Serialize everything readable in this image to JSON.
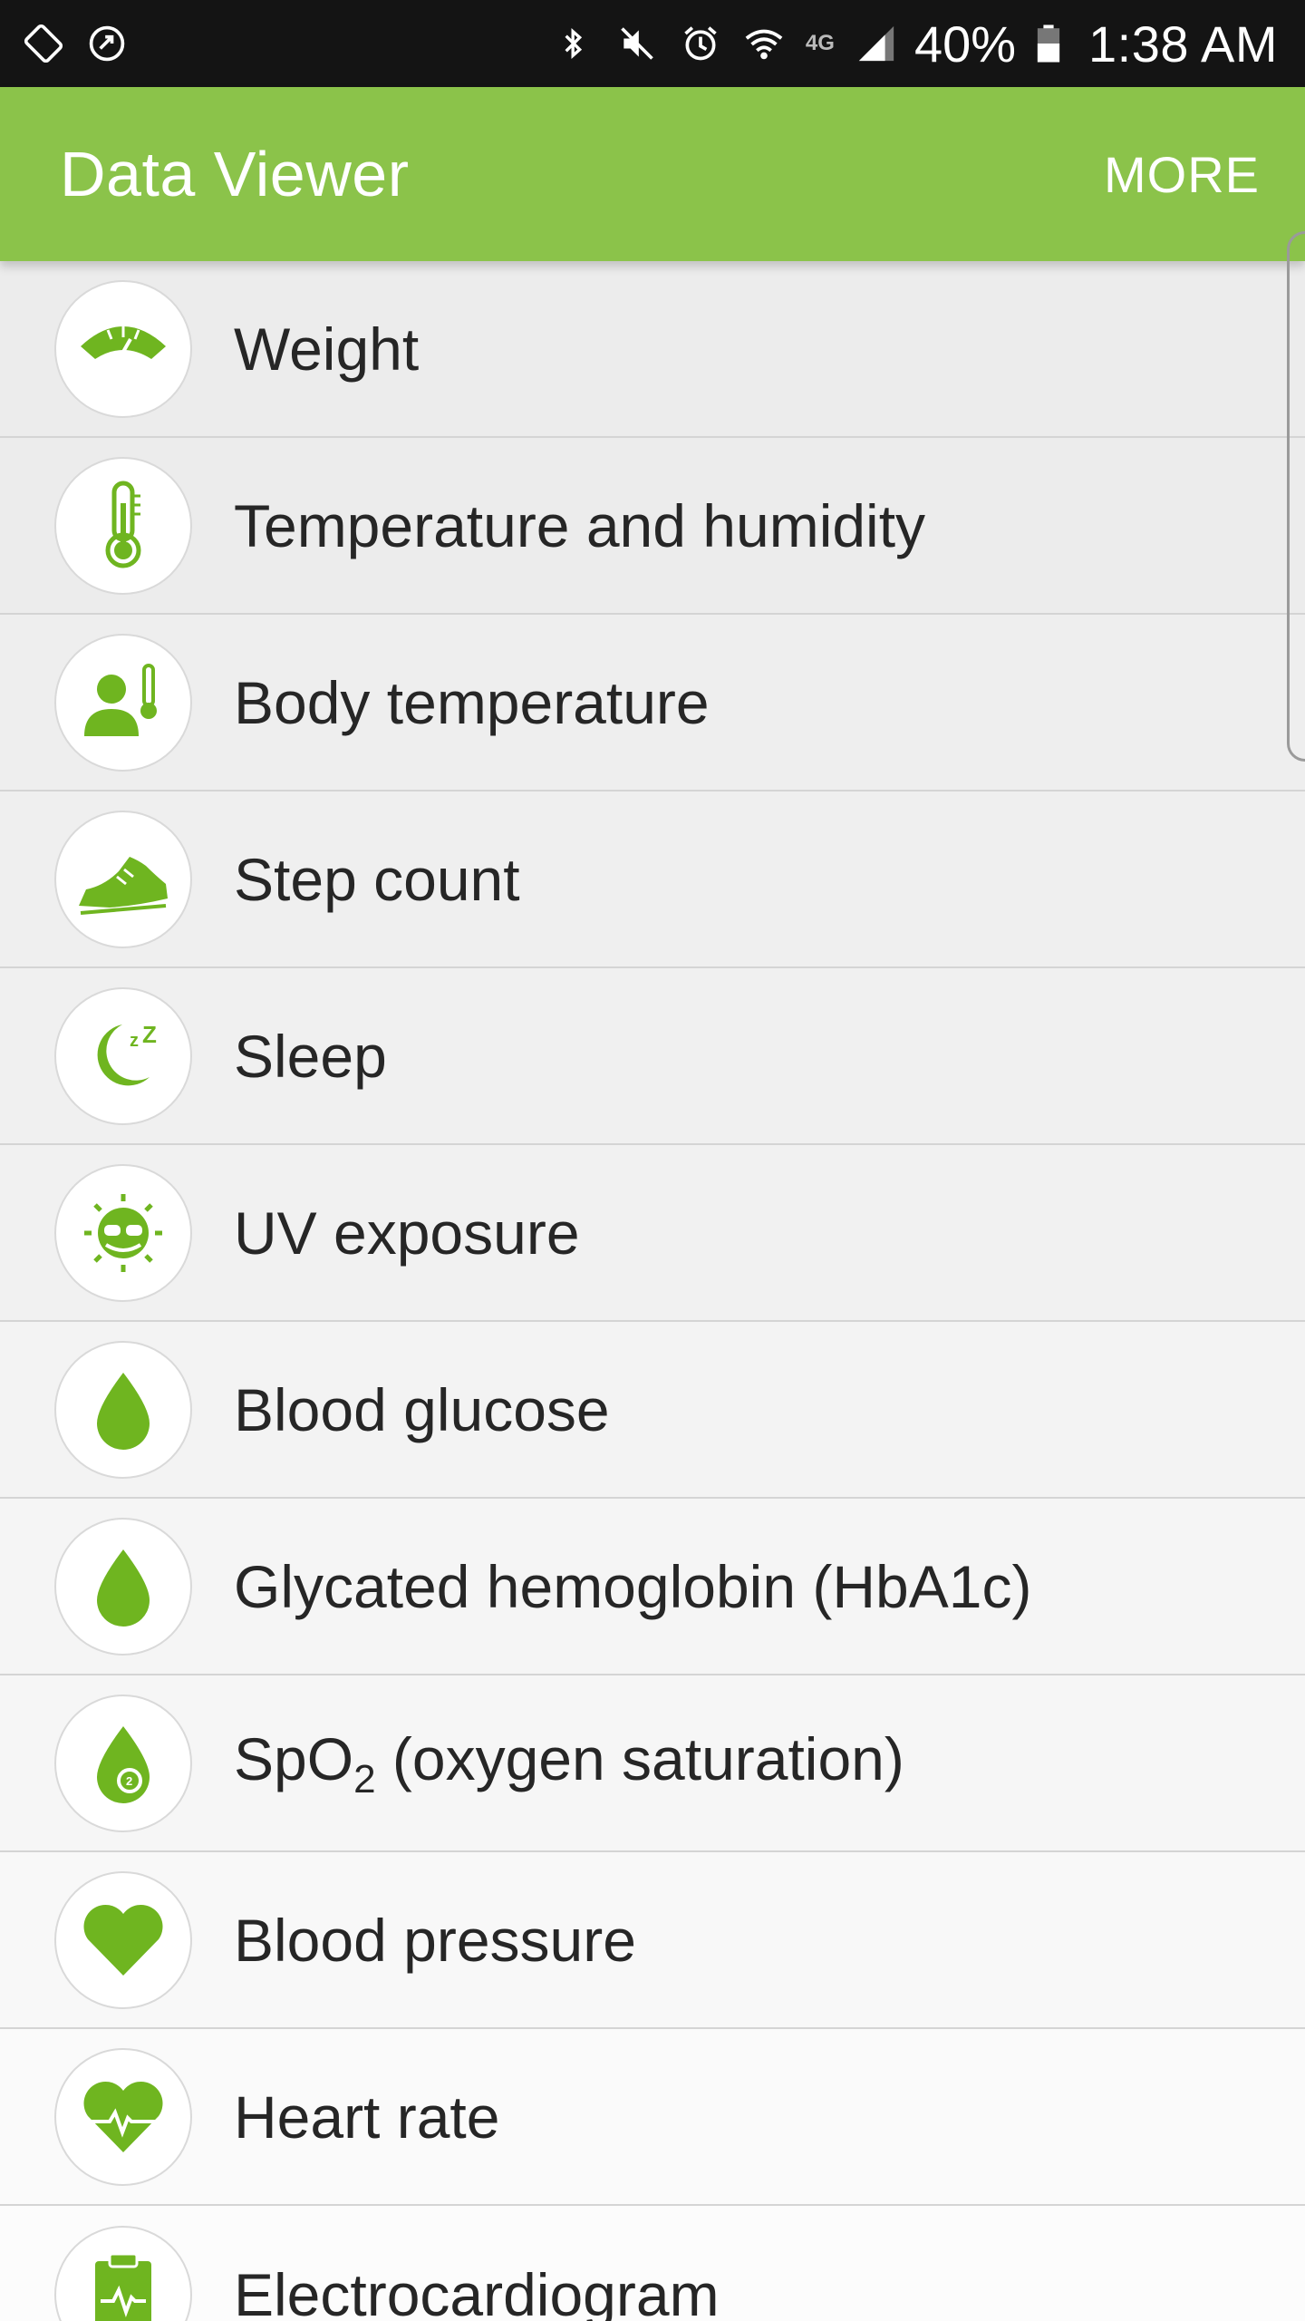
{
  "status_bar": {
    "time": "1:38 AM",
    "battery": "40%",
    "network": "4G",
    "icons": [
      "screen-rotation-icon",
      "sync-icon",
      "bluetooth-icon",
      "mute-icon",
      "alarm-icon",
      "wifi-icon",
      "signal-icon",
      "battery-icon"
    ]
  },
  "app_bar": {
    "title": "Data Viewer",
    "more_label": "MORE"
  },
  "colors": {
    "accent": "#8bc34a",
    "icon_green": "#6fb520",
    "status_bar": "#141414"
  },
  "items": [
    {
      "label": "Weight",
      "icon": "scale-icon"
    },
    {
      "label": "Temperature and humidity",
      "icon": "thermometer-icon"
    },
    {
      "label": "Body temperature",
      "icon": "body-temperature-icon"
    },
    {
      "label": "Step count",
      "icon": "shoe-icon"
    },
    {
      "label": "Sleep",
      "icon": "moon-sleep-icon"
    },
    {
      "label": "UV exposure",
      "icon": "sun-sunglasses-icon"
    },
    {
      "label": "Blood glucose",
      "icon": "drop-icon"
    },
    {
      "label": "Glycated hemoglobin (HbA1c)",
      "icon": "drop-icon"
    },
    {
      "label_pre": "SpO",
      "label_sub": "2",
      "label_post": " (oxygen saturation)",
      "icon": "oxygen-drop-icon"
    },
    {
      "label": "Blood pressure",
      "icon": "heart-icon"
    },
    {
      "label": "Heart rate",
      "icon": "heart-pulse-icon"
    },
    {
      "label": "Electrocardiogram",
      "icon": "ecg-clipboard-icon"
    }
  ]
}
